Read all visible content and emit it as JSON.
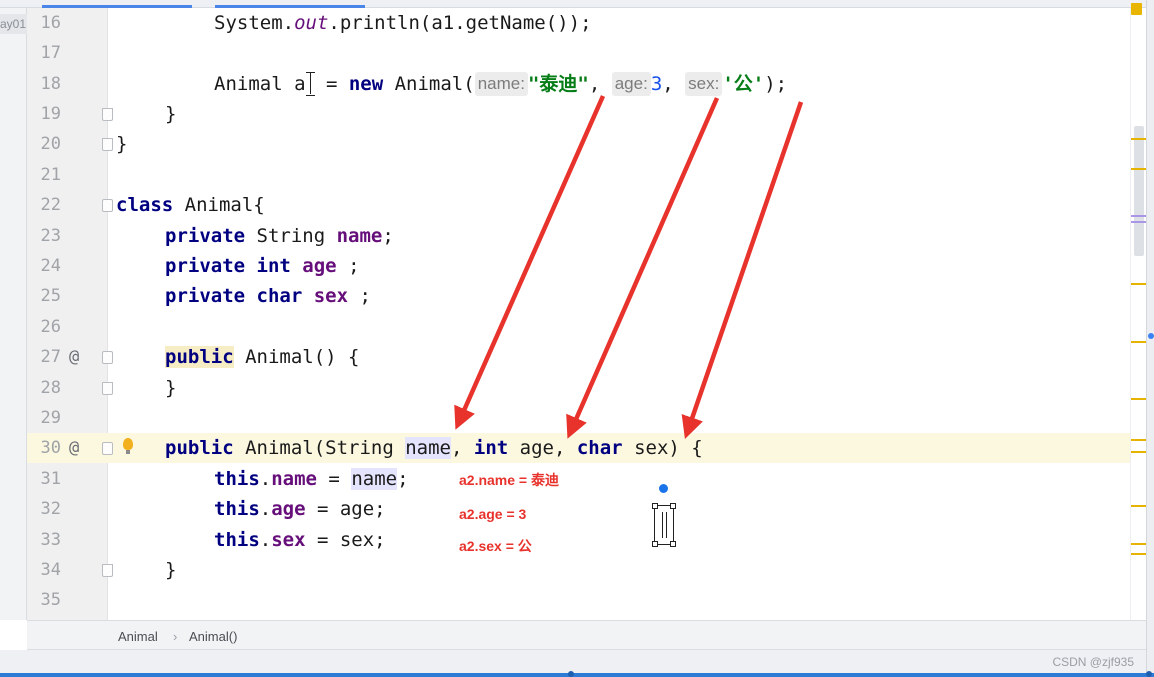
{
  "left_tool": {
    "label": "ay01"
  },
  "lines": [
    {
      "n": "16"
    },
    {
      "n": "17"
    },
    {
      "n": "18"
    },
    {
      "n": "19"
    },
    {
      "n": "20"
    },
    {
      "n": "21"
    },
    {
      "n": "22"
    },
    {
      "n": "23"
    },
    {
      "n": "24"
    },
    {
      "n": "25"
    },
    {
      "n": "26"
    },
    {
      "n": "27"
    },
    {
      "n": "28"
    },
    {
      "n": "29"
    },
    {
      "n": "30"
    },
    {
      "n": "31"
    },
    {
      "n": "32"
    },
    {
      "n": "33"
    },
    {
      "n": "34"
    },
    {
      "n": "35"
    }
  ],
  "gutter": {
    "override_marker": "@"
  },
  "code": {
    "l16_a": "System.",
    "l16_out": "out",
    "l16_b": ".println(a1.getName());",
    "l18_a": "Animal a",
    "l18_b": " = ",
    "l18_new": "new",
    "l18_c": " Animal(",
    "l18_hint_name": "name:",
    "l18_name_val": "\"泰迪\"",
    "l18_comma1": ", ",
    "l18_hint_age": "age:",
    "l18_age_val": "3",
    "l18_comma2": ", ",
    "l18_hint_sex": "sex:",
    "l18_sex_val": "'公'",
    "l18_end": ");",
    "l19": "}",
    "l20": "}",
    "l22_kw": "class",
    "l22_rest": " Animal{",
    "l23_kw": "private",
    "l23_type": " String ",
    "l23_field": "name",
    "l23_end": ";",
    "l24_kw": "private",
    "l24_type": " int",
    "l24_sp": " ",
    "l24_field": "age",
    "l24_end": " ;",
    "l25_kw": "private",
    "l25_type": " char",
    "l25_sp": " ",
    "l25_field": "sex",
    "l25_end": " ;",
    "l27_kw": "public",
    "l27_rest": " Animal() {",
    "l28": "}",
    "l30_kw": "public",
    "l30_a": " Animal(String ",
    "l30_name": "name",
    "l30_b": ", ",
    "l30_int": "int",
    "l30_c": " age, ",
    "l30_char": "char",
    "l30_d": " sex) {",
    "l31_this": "this",
    "l31_dot": ".",
    "l31_field": "name",
    "l31_eq": " = ",
    "l31_param": "name",
    "l31_end": ";",
    "l32_this": "this",
    "l32_dot": ".",
    "l32_field": "age",
    "l32_rest": " = age;",
    "l33_this": "this",
    "l33_dot": ".",
    "l33_field": "sex",
    "l33_rest": " = sex;",
    "l34": "}"
  },
  "annotations": {
    "name": "a2.name = 泰迪",
    "age": "a2.age = 3",
    "sex": "a2.sex = 公"
  },
  "breadcrumb": {
    "class": "Animal",
    "sep": "›",
    "method": "Animal()"
  },
  "watermark": "CSDN @zjf935",
  "colors": {
    "arrow": "#e8322c",
    "keyword": "#000080",
    "field": "#660e7a",
    "string": "#067d17",
    "number": "#1750eb",
    "accent": "#2e7bd6"
  }
}
